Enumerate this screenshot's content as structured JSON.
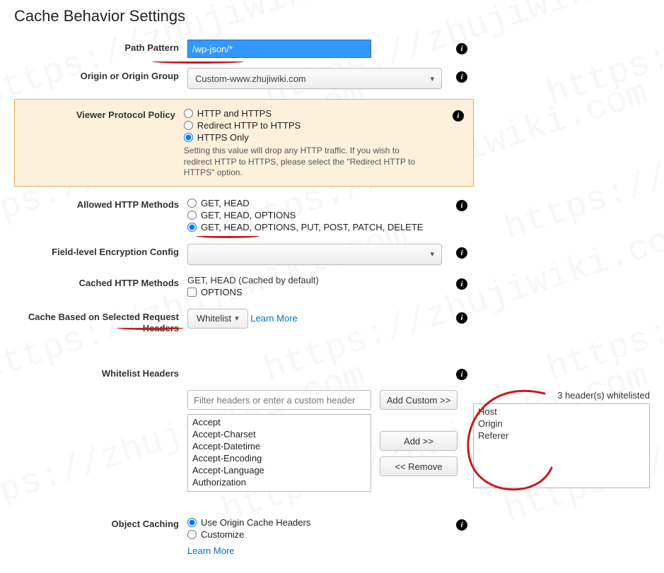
{
  "page_title": "Cache Behavior Settings",
  "path_pattern": {
    "label": "Path Pattern",
    "value": "/wp-json/*"
  },
  "origin": {
    "label": "Origin or Origin Group",
    "selected": "Custom-www.zhujiwiki.com"
  },
  "viewer_protocol": {
    "label": "Viewer Protocol Policy",
    "options": [
      "HTTP and HTTPS",
      "Redirect HTTP to HTTPS",
      "HTTPS Only"
    ],
    "selected_index": 2,
    "hint": "Setting this value will drop any HTTP traffic. If you wish to redirect HTTP to HTTPS, please select the \"Redirect HTTP to HTTPS\" option."
  },
  "allowed_methods": {
    "label": "Allowed HTTP Methods",
    "options": [
      "GET, HEAD",
      "GET, HEAD, OPTIONS",
      "GET, HEAD, OPTIONS, PUT, POST, PATCH, DELETE"
    ],
    "selected_index": 2
  },
  "field_level_encryption": {
    "label": "Field-level Encryption Config",
    "selected": ""
  },
  "cached_methods": {
    "label": "Cached HTTP Methods",
    "static_text": "GET, HEAD (Cached by default)",
    "checkbox_label": "OPTIONS",
    "checkbox_checked": false
  },
  "cache_headers": {
    "label": "Cache Based on Selected Request Headers",
    "button_label": "Whitelist",
    "learn_more": "Learn More"
  },
  "whitelist_headers": {
    "label": "Whitelist Headers",
    "filter_placeholder": "Filter headers or enter a custom header",
    "available": [
      "Accept",
      "Accept-Charset",
      "Accept-Datetime",
      "Accept-Encoding",
      "Accept-Language",
      "Authorization"
    ],
    "add_custom_btn": "Add Custom >>",
    "add_btn": "Add >>",
    "remove_btn": "<< Remove",
    "selected": [
      "Host",
      "Origin",
      "Referer"
    ],
    "count_caption": "3 header(s) whitelisted"
  },
  "object_caching": {
    "label": "Object Caching",
    "options": [
      "Use Origin Cache Headers",
      "Customize"
    ],
    "selected_index": 0,
    "learn_more": "Learn More"
  },
  "watermark_text": "https://zhujiwiki.com"
}
